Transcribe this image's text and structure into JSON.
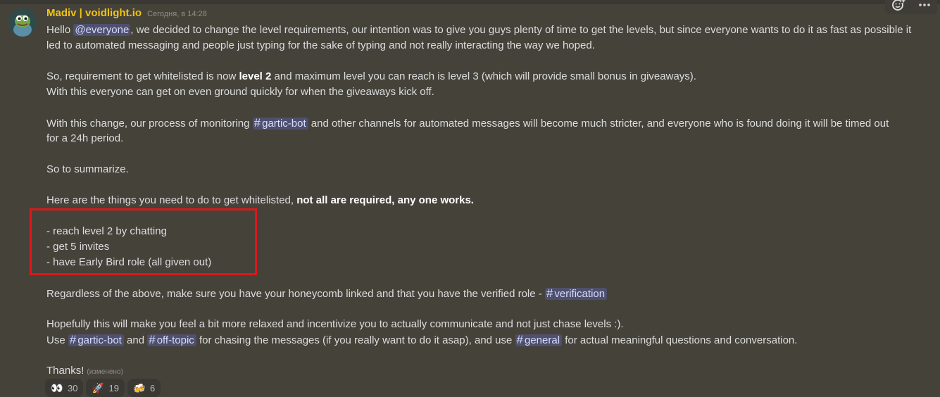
{
  "message": {
    "author": "Madiv | voidlight.io",
    "timestamp": "Сегодня, в 14:28",
    "edited_label": "(изменено)",
    "author_color": "#f1c40f",
    "mention_everyone": "@everyone",
    "channels": {
      "gartic_bot": "gartic-bot",
      "verification": "verification",
      "off_topic": "off-topic",
      "general": "general"
    },
    "lines": {
      "l1_pre": "Hello ",
      "l1_post": ", we decided to change the level requirements, our intention was to give you guys plenty of time to get the levels, but since everyone wants to do it as fast as possible it",
      "l2": "led to automated messaging and people just typing for the sake of typing and not really interacting the way we hoped.",
      "l3_pre": "So, requirement to get whitelisted is now ",
      "l3_bold": "level 2",
      "l3_post": " and maximum level you can reach is level 3 (which will provide small bonus in giveaways).",
      "l4": "With this everyone can get on even ground quickly for when the giveaways kick off.",
      "l5_pre": "With this change, our process of monitoring ",
      "l5_post": " and other channels for automated messages will become much stricter, and everyone who is found doing it will be timed out",
      "l6": "for a 24h period.",
      "l7": "So to summarize.",
      "l8_pre": "Here are the things you need to do to get whitelisted, ",
      "l8_bold": "not all are required, any one works.",
      "l9": "- reach level 2 by chatting",
      "l10": "- get 5 invites",
      "l11": "- have Early Bird role (all given out)",
      "l12_pre": "Regardless of the above, make sure you have your honeycomb linked and that you have the verified role - ",
      "l13": "Hopefully this will make you feel a bit more relaxed and incentivize you to actually communicate and not just chase levels :).",
      "l14_a": "Use ",
      "l14_b": " and ",
      "l14_c": " for chasing the messages (if you really want to do it asap), and use ",
      "l14_d": " for actual meaningful questions and conversation.",
      "l15": "Thanks!"
    }
  },
  "reactions": [
    {
      "icon": "eyes-emoji",
      "glyph": "👀",
      "count": "30"
    },
    {
      "icon": "rocket-emoji",
      "glyph": "🚀",
      "count": "19"
    },
    {
      "icon": "beer-emoji",
      "glyph": "🍻",
      "count": "6"
    }
  ],
  "toolbar": {
    "add_reaction_icon": "add-reaction-icon",
    "more_icon": "more-options-icon"
  }
}
